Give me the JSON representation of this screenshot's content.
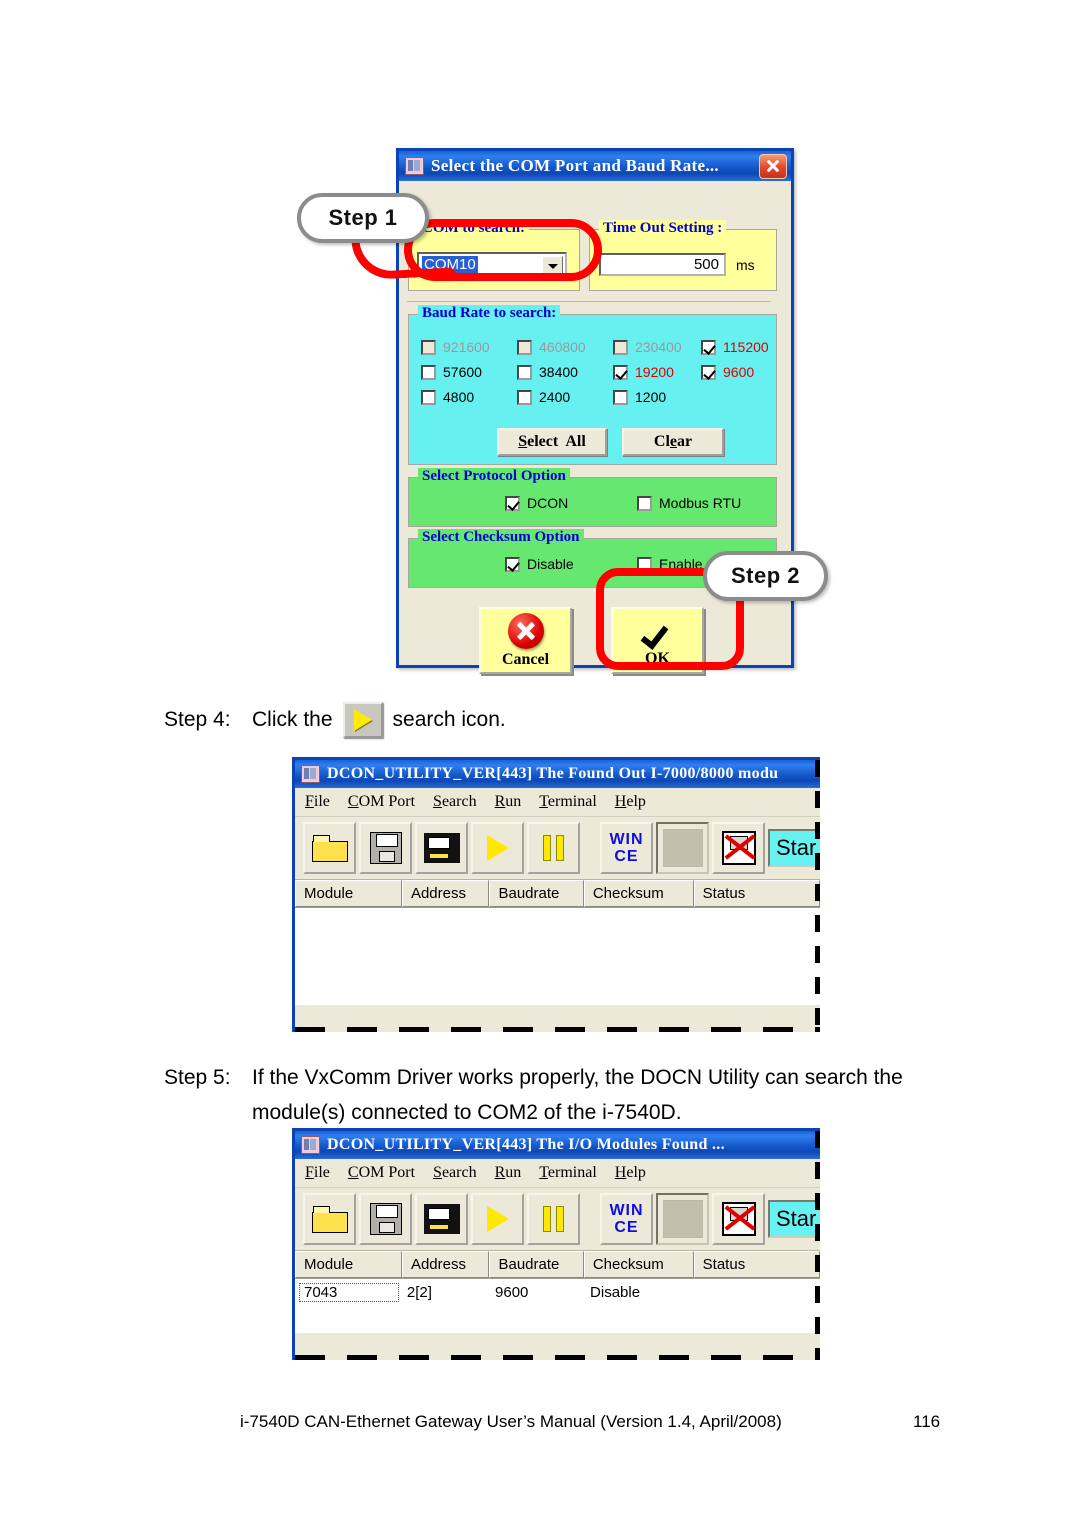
{
  "document": {
    "footer_text": "i-7540D CAN-Ethernet Gateway User’s Manual (Version 1.4, April/2008)",
    "page_number": "116"
  },
  "dialog": {
    "title": "Select the COM Port and Baud Rate...",
    "icon": "book-icon",
    "close_label": "✕",
    "com_group": {
      "title": "COM to search:",
      "selected_value": "COM10"
    },
    "timeout_group": {
      "title": "Time Out Setting :",
      "value": "500",
      "unit": "ms"
    },
    "baud_group": {
      "title": "Baud Rate to search:",
      "options": [
        {
          "label": "921600",
          "checked": false,
          "enabled": false
        },
        {
          "label": "460800",
          "checked": false,
          "enabled": false
        },
        {
          "label": "230400",
          "checked": false,
          "enabled": false
        },
        {
          "label": "115200",
          "checked": true,
          "enabled": true
        },
        {
          "label": "57600",
          "checked": false,
          "enabled": true
        },
        {
          "label": "38400",
          "checked": false,
          "enabled": true
        },
        {
          "label": "19200",
          "checked": true,
          "enabled": true
        },
        {
          "label": "9600",
          "checked": true,
          "enabled": true
        },
        {
          "label": "4800",
          "checked": false,
          "enabled": true
        },
        {
          "label": "2400",
          "checked": false,
          "enabled": true
        },
        {
          "label": "1200",
          "checked": false,
          "enabled": true
        }
      ],
      "select_all_label": "Select  All",
      "clear_label": "Clear"
    },
    "protocol_group": {
      "title": "Select Protocol Option",
      "options": [
        {
          "label": "DCON",
          "checked": true
        },
        {
          "label": "Modbus RTU",
          "checked": false
        }
      ]
    },
    "checksum_group": {
      "title": "Select Checksum  Option",
      "options": [
        {
          "label": "Disable",
          "checked": true
        },
        {
          "label": "Enable",
          "checked": false
        }
      ]
    },
    "cancel_label": "Cancel",
    "ok_label": "OK"
  },
  "callouts": {
    "step1": "Step 1",
    "step2": "Step 2"
  },
  "step4": {
    "label": "Step 4:",
    "text_before": "Click the",
    "text_after": "search icon.",
    "icon": "play-search-icon"
  },
  "step5": {
    "label": "Step 5:",
    "text": "If the VxComm Driver works properly, the DOCN Utility can search the module(s) connected to COM2 of the i-7540D."
  },
  "dcon_window_1": {
    "title": "DCON_UTILITY_VER[443] The Found Out I-7000/8000 modu",
    "menu": [
      "File",
      "COM Port",
      "Search",
      "Run",
      "Terminal",
      "Help"
    ],
    "toolbar_icons": [
      "folder-open-icon",
      "save-disk-icon",
      "printer-icon",
      "play-search-icon",
      "pause-icon",
      "wince-icon",
      "blank-icon",
      "disconnect-plug-icon"
    ],
    "start_box_label": "Star",
    "columns": [
      "Module",
      "Address",
      "Baudrate",
      "Checksum",
      "Status"
    ],
    "rows": []
  },
  "dcon_window_2": {
    "title": "DCON_UTILITY_VER[443] The I/O Modules Found ...",
    "menu": [
      "File",
      "COM Port",
      "Search",
      "Run",
      "Terminal",
      "Help"
    ],
    "toolbar_icons": [
      "folder-open-icon",
      "save-disk-icon",
      "printer-icon",
      "play-search-icon",
      "pause-icon",
      "wince-icon",
      "blank-icon",
      "disconnect-plug-icon"
    ],
    "start_box_label": "Star",
    "columns": [
      "Module",
      "Address",
      "Baudrate",
      "Checksum",
      "Status"
    ],
    "rows": [
      {
        "module": "7043",
        "address": "2[2]",
        "baudrate": "9600",
        "checksum": "Disable",
        "status": ""
      }
    ]
  },
  "colors": {
    "titlebar_blue": "#0a44b4",
    "dialog_face": "#ece9d8",
    "yellow_group": "#ffff9c",
    "cyan_group": "#66f0f0",
    "green_group": "#66e870",
    "highlight_red": "#ff0000",
    "checked_label_red": "#e00000",
    "button_yellow": "#ffff9c",
    "start_cyan": "#66f2f2"
  }
}
